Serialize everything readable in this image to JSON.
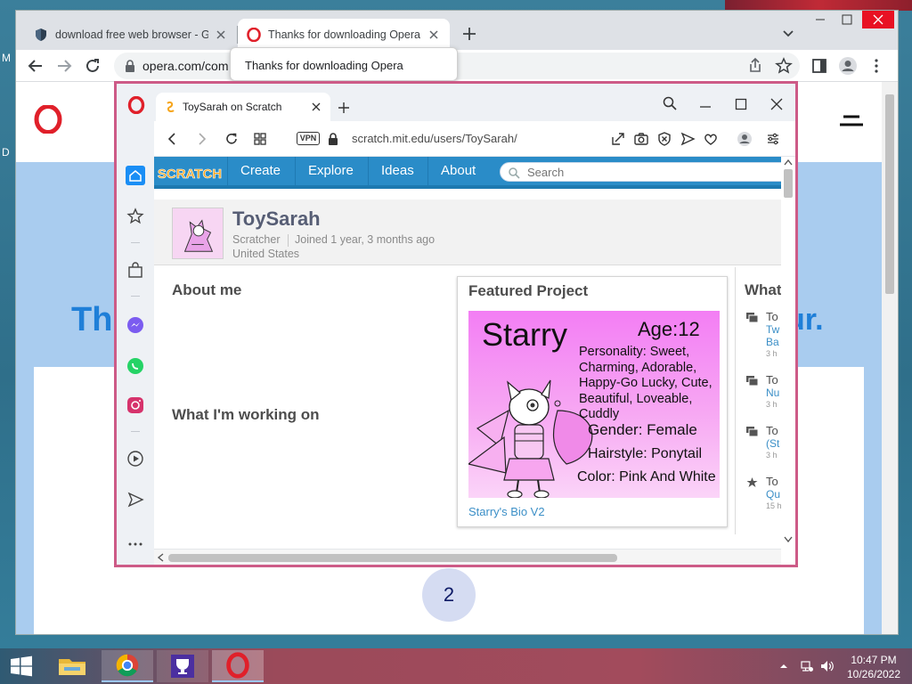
{
  "chrome": {
    "tabs": [
      {
        "title": "download free web browser - Go",
        "icon": "shield-icon"
      },
      {
        "title": "Thanks for downloading Opera",
        "icon": "opera-icon"
      }
    ],
    "url": "opera.com/com",
    "tooltip": "Thanks for downloading Opera"
  },
  "opera_page": {
    "big_left": "Th",
    "big_right": "ur.",
    "step_number": "2"
  },
  "opera": {
    "tab_title": "ToySarah on Scratch",
    "vpn_label": "VPN",
    "url": "scratch.mit.edu/users/ToySarah/"
  },
  "scratch": {
    "logo_text": "SCRATCH",
    "nav": [
      "Create",
      "Explore",
      "Ideas",
      "About"
    ],
    "search_placeholder": "Search",
    "profile": {
      "username": "ToySarah",
      "role": "Scratcher",
      "joined": "Joined 1 year, 3 months ago",
      "country": "United States"
    },
    "about_heading": "About me",
    "working_heading": "What I'm working on",
    "featured": {
      "heading": "Featured Project",
      "image_title": "Starry",
      "image_age": "Age:12",
      "image_bio": "Personality: Sweet, Charming, Adorable, Happy-Go Lucky, Cute, Beautiful, Loveable, Cuddly",
      "image_gender": "Gender: Female",
      "image_hair": "Hairstyle: Ponytail",
      "image_color": "Color: Pink And White",
      "link": "Starry's Bio V2"
    },
    "side_heading": "What",
    "activity": [
      {
        "l1": "To",
        "l2": "Tw Ba",
        "l3": "3 h"
      },
      {
        "l1": "To",
        "l2": "Nu",
        "l3": "3 h"
      },
      {
        "l1": "To",
        "l2": "(St",
        "l3": "3 h"
      },
      {
        "l1": "To",
        "l2": "Qu",
        "l3": "15 h"
      }
    ]
  },
  "taskbar": {
    "time": "10:47 PM",
    "date": "10/26/2022"
  },
  "desktop": {
    "label_m": "M",
    "label_d": "D"
  },
  "colors": {
    "scratch_blue": "#2a8cc8",
    "opera_red": "#e0202a",
    "opera_border": "#cd5b87",
    "link_blue": "#3b8fc7"
  }
}
